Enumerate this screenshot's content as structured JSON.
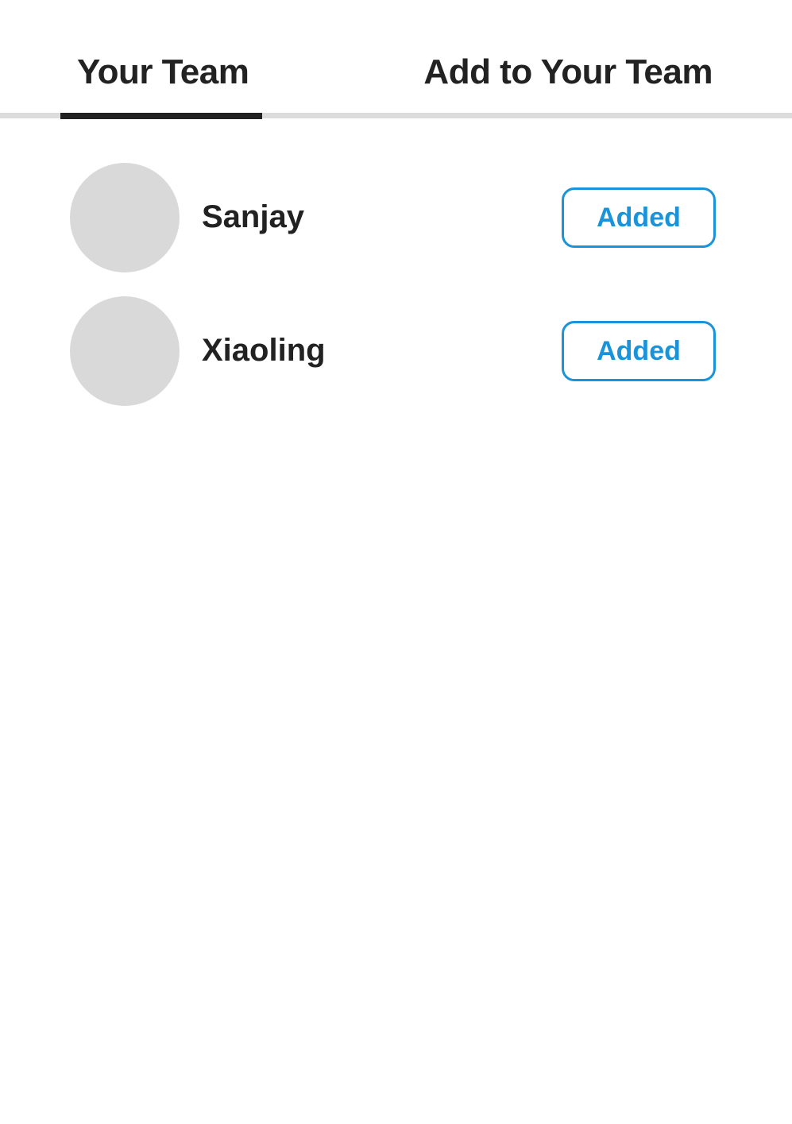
{
  "tabs": {
    "your_team": "Your Team",
    "add_to_team": "Add to Your Team",
    "active": "your_team"
  },
  "members": [
    {
      "name": "Sanjay",
      "status_label": "Added"
    },
    {
      "name": "Xiaoling",
      "status_label": "Added"
    }
  ],
  "colors": {
    "accent": "#1a93d8",
    "text": "#222222",
    "avatar_placeholder": "#d9d9d9",
    "tab_rule": "#dcdcdc"
  }
}
